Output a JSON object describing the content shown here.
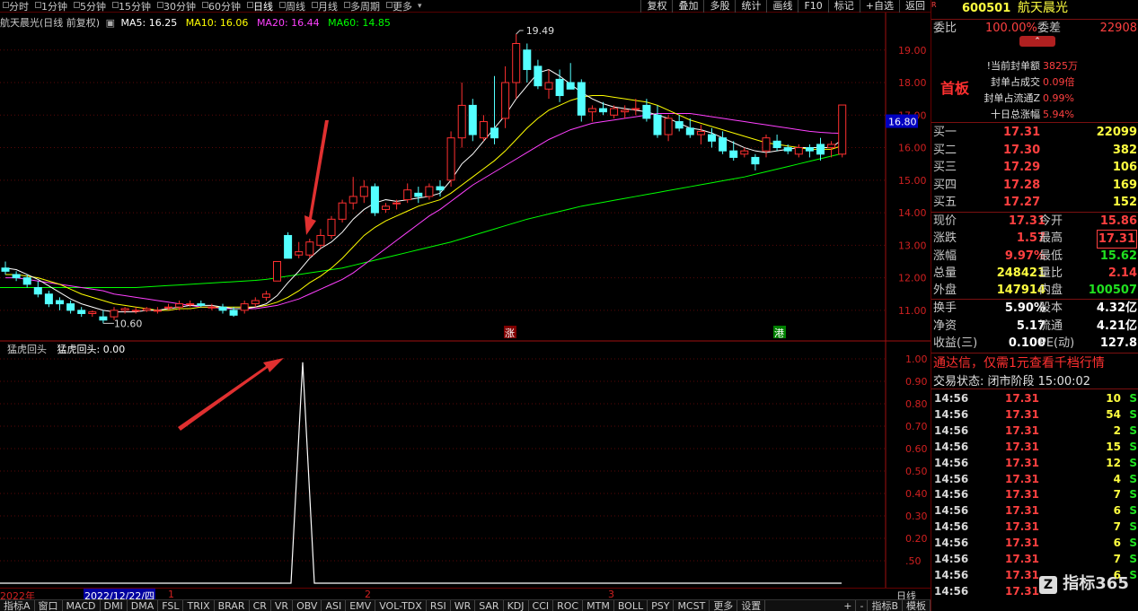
{
  "topbar": {
    "tabs": [
      "分时",
      "1分钟",
      "5分钟",
      "15分钟",
      "30分钟",
      "60分钟",
      "日线",
      "周线",
      "月线",
      "多周期",
      "更多"
    ],
    "active_tab": "日线",
    "buttons": [
      "复权",
      "叠加",
      "多股",
      "统计",
      "画线",
      "F10",
      "标记",
      "+自选",
      "返回"
    ]
  },
  "legend": {
    "title": "航天晨光(日线 前复权)",
    "ma5": "MA5: 16.25",
    "ma10": "MA10: 16.06",
    "ma20": "MA20: 16.44",
    "ma60": "MA60: 14.85",
    "colors": {
      "ma5": "#ffffff",
      "ma10": "#ffff00",
      "ma20": "#ff40ff",
      "ma60": "#00ff00"
    }
  },
  "indicator": {
    "title": "猛虎回头",
    "value_label": "猛虎回头: 0.00"
  },
  "price_axis": {
    "labels": [
      "19.00",
      "18.00",
      "17.00",
      "16.00",
      "15.00",
      "14.00",
      "13.00",
      "12.00",
      "11.00"
    ],
    "current": "16.80",
    "high_label": "19.49",
    "low_label": "10.60",
    "mark_zhang": "涨",
    "mark_gang": "港"
  },
  "indicator_axis": {
    "labels": [
      "1.00",
      "0.90",
      "0.80",
      "0.70",
      "0.60",
      "0.50",
      "0.40",
      "0.30",
      "0.20",
      ".50"
    ]
  },
  "chart_data": {
    "type": "candlestick",
    "title": "航天晨光(日线 前复权)",
    "ylim": [
      10.5,
      19.6
    ],
    "candles": [
      [
        12.3,
        12.5,
        12.1,
        12.2
      ],
      [
        12.1,
        12.2,
        11.9,
        12.0
      ],
      [
        12.0,
        12.1,
        11.7,
        11.8
      ],
      [
        11.7,
        11.9,
        11.4,
        11.5
      ],
      [
        11.5,
        11.6,
        11.1,
        11.2
      ],
      [
        11.3,
        11.4,
        11.0,
        11.2
      ],
      [
        11.2,
        11.3,
        10.9,
        11.0
      ],
      [
        11.0,
        11.1,
        10.8,
        10.9
      ],
      [
        10.9,
        11.0,
        10.8,
        10.95
      ],
      [
        10.8,
        11.0,
        10.6,
        10.7
      ],
      [
        10.8,
        11.1,
        10.7,
        11.0
      ],
      [
        11.0,
        11.1,
        10.9,
        11.05
      ],
      [
        11.0,
        11.1,
        10.9,
        11.0
      ],
      [
        11.0,
        11.1,
        10.95,
        11.05
      ],
      [
        11.0,
        11.1,
        10.9,
        11.0
      ],
      [
        11.1,
        11.2,
        11.0,
        11.1
      ],
      [
        11.1,
        11.3,
        11.0,
        11.2
      ],
      [
        11.2,
        11.3,
        11.1,
        11.2
      ],
      [
        11.2,
        11.3,
        11.1,
        11.15
      ],
      [
        11.1,
        11.2,
        11.0,
        11.1
      ],
      [
        11.1,
        11.2,
        10.9,
        11.0
      ],
      [
        11.0,
        11.1,
        10.8,
        10.85
      ],
      [
        11.0,
        11.3,
        10.9,
        11.2
      ],
      [
        11.2,
        11.4,
        11.1,
        11.3
      ],
      [
        11.4,
        11.6,
        11.3,
        11.5
      ],
      [
        11.9,
        12.5,
        11.9,
        12.5
      ],
      [
        13.3,
        13.4,
        12.6,
        12.6
      ],
      [
        12.7,
        13.1,
        12.6,
        12.8
      ],
      [
        12.7,
        13.2,
        12.6,
        13.1
      ],
      [
        13.0,
        13.5,
        12.9,
        13.3
      ],
      [
        13.3,
        13.9,
        13.2,
        13.8
      ],
      [
        13.8,
        14.4,
        13.7,
        14.3
      ],
      [
        14.3,
        15.1,
        14.1,
        14.5
      ],
      [
        14.5,
        15.0,
        14.3,
        14.8
      ],
      [
        14.8,
        14.9,
        13.9,
        14.0
      ],
      [
        14.1,
        14.3,
        14.0,
        14.2
      ],
      [
        14.3,
        14.4,
        14.1,
        14.3
      ],
      [
        14.4,
        14.9,
        14.3,
        14.7
      ],
      [
        14.6,
        14.8,
        14.3,
        14.5
      ],
      [
        14.5,
        14.9,
        14.4,
        14.8
      ],
      [
        14.8,
        15.0,
        14.5,
        14.7
      ],
      [
        15.0,
        16.5,
        14.8,
        16.3
      ],
      [
        16.3,
        18.0,
        16.0,
        17.3
      ],
      [
        17.3,
        17.5,
        16.2,
        16.4
      ],
      [
        16.3,
        17.0,
        16.2,
        16.8
      ],
      [
        16.6,
        18.2,
        16.1,
        16.3
      ],
      [
        16.9,
        18.5,
        16.6,
        18.0
      ],
      [
        18.0,
        19.49,
        17.5,
        19.2
      ],
      [
        19.0,
        19.2,
        18.0,
        18.4
      ],
      [
        18.5,
        18.7,
        17.8,
        17.9
      ],
      [
        17.8,
        18.4,
        17.5,
        18.0
      ],
      [
        18.1,
        18.4,
        17.4,
        17.6
      ],
      [
        18.0,
        18.6,
        17.8,
        17.8
      ],
      [
        18.0,
        18.1,
        16.8,
        17.0
      ],
      [
        17.1,
        17.3,
        16.8,
        17.2
      ],
      [
        17.2,
        17.4,
        17.0,
        17.1
      ],
      [
        17.0,
        17.3,
        16.9,
        17.2
      ],
      [
        17.1,
        17.3,
        16.9,
        17.15
      ],
      [
        17.2,
        17.5,
        17.0,
        17.2
      ],
      [
        17.3,
        17.5,
        16.8,
        16.9
      ],
      [
        17.0,
        17.3,
        16.3,
        16.4
      ],
      [
        16.4,
        17.0,
        16.2,
        16.9
      ],
      [
        16.8,
        17.0,
        16.5,
        16.6
      ],
      [
        16.6,
        16.9,
        16.3,
        16.4
      ],
      [
        16.4,
        16.7,
        16.1,
        16.5
      ],
      [
        16.4,
        16.6,
        16.0,
        16.2
      ],
      [
        16.3,
        16.5,
        15.8,
        15.9
      ],
      [
        15.9,
        16.2,
        15.6,
        15.7
      ],
      [
        15.8,
        16.0,
        15.7,
        15.9
      ],
      [
        15.7,
        15.8,
        15.3,
        15.5
      ],
      [
        15.9,
        16.4,
        15.7,
        16.3
      ],
      [
        16.2,
        16.4,
        15.9,
        16.0
      ],
      [
        16.0,
        16.1,
        15.8,
        15.9
      ],
      [
        15.8,
        16.1,
        15.7,
        16.0
      ],
      [
        16.0,
        16.1,
        15.7,
        15.9
      ],
      [
        16.1,
        16.3,
        15.6,
        15.8
      ],
      [
        16.0,
        16.2,
        15.7,
        16.1
      ],
      [
        15.8,
        17.31,
        15.7,
        17.31
      ]
    ],
    "ma5": [
      12.3,
      12.25,
      12.1,
      11.95,
      11.75,
      11.55,
      11.35,
      11.2,
      11.1,
      11.0,
      10.95,
      10.95,
      10.95,
      11.0,
      11.0,
      11.05,
      11.1,
      11.15,
      11.15,
      11.15,
      11.1,
      11.05,
      11.05,
      11.1,
      11.2,
      11.45,
      11.85,
      12.2,
      12.6,
      12.9,
      13.1,
      13.4,
      13.8,
      14.1,
      14.3,
      14.4,
      14.35,
      14.4,
      14.45,
      14.5,
      14.6,
      15.0,
      15.5,
      15.8,
      16.2,
      16.6,
      17.0,
      17.5,
      17.9,
      18.3,
      18.4,
      18.2,
      17.95,
      17.7,
      17.5,
      17.35,
      17.25,
      17.2,
      17.15,
      17.1,
      17.0,
      16.9,
      16.75,
      16.6,
      16.55,
      16.45,
      16.3,
      16.15,
      16.0,
      15.9,
      15.85,
      15.9,
      15.95,
      16.0,
      16.0,
      16.0,
      16.0,
      16.25
    ],
    "ma10": [
      12.1,
      12.1,
      12.05,
      12.0,
      11.9,
      11.8,
      11.65,
      11.5,
      11.4,
      11.3,
      11.2,
      11.15,
      11.1,
      11.05,
      11.0,
      11.0,
      11.05,
      11.05,
      11.1,
      11.1,
      11.1,
      11.1,
      11.1,
      11.1,
      11.15,
      11.25,
      11.4,
      11.6,
      11.85,
      12.05,
      12.3,
      12.6,
      12.95,
      13.3,
      13.55,
      13.75,
      13.9,
      14.05,
      14.2,
      14.3,
      14.4,
      14.6,
      14.85,
      15.1,
      15.35,
      15.6,
      15.9,
      16.25,
      16.6,
      16.9,
      17.15,
      17.3,
      17.45,
      17.55,
      17.6,
      17.6,
      17.55,
      17.5,
      17.45,
      17.4,
      17.3,
      17.15,
      17.0,
      16.85,
      16.75,
      16.65,
      16.55,
      16.45,
      16.35,
      16.25,
      16.15,
      16.1,
      16.05,
      16.0,
      15.95,
      15.95,
      15.95,
      16.06
    ],
    "ma20": [
      12.0,
      12.0,
      11.95,
      11.9,
      11.85,
      11.8,
      11.75,
      11.7,
      11.65,
      11.6,
      11.5,
      11.45,
      11.4,
      11.35,
      11.3,
      11.25,
      11.2,
      11.15,
      11.1,
      11.1,
      11.05,
      11.05,
      11.05,
      11.05,
      11.1,
      11.15,
      11.25,
      11.35,
      11.5,
      11.65,
      11.8,
      11.95,
      12.15,
      12.4,
      12.65,
      12.9,
      13.15,
      13.4,
      13.65,
      13.9,
      14.1,
      14.35,
      14.6,
      14.85,
      15.05,
      15.25,
      15.45,
      15.65,
      15.85,
      16.05,
      16.25,
      16.4,
      16.55,
      16.65,
      16.75,
      16.8,
      16.85,
      16.9,
      16.95,
      17.0,
      17.05,
      17.05,
      17.05,
      17.05,
      17.0,
      16.95,
      16.9,
      16.85,
      16.8,
      16.75,
      16.7,
      16.65,
      16.6,
      16.55,
      16.5,
      16.47,
      16.45,
      16.44
    ],
    "ma60": [
      11.7,
      11.7,
      11.7,
      11.7,
      11.7,
      11.7,
      11.7,
      11.7,
      11.7,
      11.7,
      11.7,
      11.7,
      11.7,
      11.72,
      11.74,
      11.76,
      11.78,
      11.8,
      11.82,
      11.84,
      11.86,
      11.88,
      11.9,
      11.92,
      11.95,
      12.0,
      12.05,
      12.1,
      12.15,
      12.2,
      12.25,
      12.3,
      12.38,
      12.46,
      12.54,
      12.62,
      12.7,
      12.78,
      12.86,
      12.94,
      13.02,
      13.1,
      13.2,
      13.3,
      13.4,
      13.5,
      13.6,
      13.7,
      13.8,
      13.88,
      13.96,
      14.04,
      14.12,
      14.2,
      14.26,
      14.32,
      14.38,
      14.44,
      14.5,
      14.56,
      14.62,
      14.68,
      14.74,
      14.8,
      14.86,
      14.92,
      14.98,
      15.04,
      15.1,
      15.18,
      15.26,
      15.34,
      15.42,
      15.5,
      15.58,
      15.66,
      15.74,
      15.82
    ],
    "indicator_values": [
      0,
      0,
      0,
      0,
      0,
      0,
      0,
      0,
      0,
      0,
      0,
      0,
      0,
      0,
      0,
      0,
      0,
      0,
      0,
      0,
      0,
      0,
      0,
      0,
      0,
      0,
      0,
      1,
      0,
      0,
      0,
      0,
      0,
      0,
      0,
      0,
      0,
      0,
      0,
      0,
      0,
      0,
      0,
      0,
      0,
      0,
      0,
      0,
      0,
      0,
      0,
      0,
      0,
      0,
      0,
      0,
      0,
      0,
      0,
      0,
      0,
      0,
      0,
      0,
      0,
      0,
      0,
      0,
      0,
      0,
      0,
      0,
      0,
      0,
      0,
      0,
      0,
      0
    ]
  },
  "datebar": {
    "year": "2022年",
    "cursor": "2022/12/22/四",
    "months": [
      "1",
      "2",
      "3"
    ],
    "period": "日线"
  },
  "bottombar": {
    "items": [
      "指标A",
      "窗口",
      "MACD",
      "DMI",
      "DMA",
      "FSL",
      "TRIX",
      "BRAR",
      "CR",
      "VR",
      "OBV",
      "ASI",
      "EMV",
      "VOL-TDX",
      "RSI",
      "WR",
      "SAR",
      "KDJ",
      "CCI",
      "ROC",
      "MTM",
      "BOLL",
      "PSY",
      "MCST",
      "更多",
      "设置"
    ],
    "right": [
      "+",
      "-",
      "指标B",
      "模板"
    ]
  },
  "panel": {
    "code": "600501",
    "name": "航天晨光",
    "weibi_label": "委比",
    "weibi_value": "100.00%",
    "weicha_label": "委差",
    "weicha_value": "22908",
    "badge": "首板",
    "info": [
      {
        "label": "!当前封单额",
        "value": "3825万"
      },
      {
        "label": "封单占成交",
        "value": "0.09倍"
      },
      {
        "label": "封单占流通Z",
        "value": "0.99%"
      },
      {
        "label": "十日总涨幅",
        "value": "5.94%"
      }
    ],
    "buy": [
      {
        "label": "买一",
        "price": "17.31",
        "vol": "22099"
      },
      {
        "label": "买二",
        "price": "17.30",
        "vol": "382"
      },
      {
        "label": "买三",
        "price": "17.29",
        "vol": "106"
      },
      {
        "label": "买四",
        "price": "17.28",
        "vol": "169"
      },
      {
        "label": "买五",
        "price": "17.27",
        "vol": "152"
      }
    ],
    "quote": [
      {
        "l1": "现价",
        "v1": "17.31",
        "l2": "今开",
        "v2": "15.86"
      },
      {
        "l1": "涨跌",
        "v1": "1.57",
        "l2": "最高",
        "v2": "17.31"
      },
      {
        "l1": "涨幅",
        "v1": "9.97%",
        "l2": "最低",
        "v2": "15.62"
      },
      {
        "l1": "总量",
        "v1": "248421",
        "l2": "量比",
        "v2": "2.14"
      },
      {
        "l1": "外盘",
        "v1": "147914",
        "l2": "内盘",
        "v2": "100507"
      }
    ],
    "quote2": [
      {
        "l1": "换手",
        "v1": "5.90%",
        "l2": "股本",
        "v2": "4.32亿"
      },
      {
        "l1": "净资",
        "v1": "5.17",
        "l2": "流通",
        "v2": "4.21亿"
      },
      {
        "l1": "收益(三)",
        "v1": "0.100",
        "l2": "PE(动)",
        "v2": "127.8"
      }
    ],
    "promo": "通达信，仅需1元查看千档行情",
    "status": "交易状态: 闭市阶段 15:00:02",
    "ticks": [
      {
        "t": "14:56",
        "p": "17.31",
        "v": "10",
        "s": "S"
      },
      {
        "t": "14:56",
        "p": "17.31",
        "v": "54",
        "s": "S"
      },
      {
        "t": "14:56",
        "p": "17.31",
        "v": "2",
        "s": "S"
      },
      {
        "t": "14:56",
        "p": "17.31",
        "v": "15",
        "s": "S"
      },
      {
        "t": "14:56",
        "p": "17.31",
        "v": "12",
        "s": "S"
      },
      {
        "t": "14:56",
        "p": "17.31",
        "v": "4",
        "s": "S"
      },
      {
        "t": "14:56",
        "p": "17.31",
        "v": "7",
        "s": "S"
      },
      {
        "t": "14:56",
        "p": "17.31",
        "v": "6",
        "s": "S"
      },
      {
        "t": "14:56",
        "p": "17.31",
        "v": "7",
        "s": "S"
      },
      {
        "t": "14:56",
        "p": "17.31",
        "v": "6",
        "s": "S"
      },
      {
        "t": "14:56",
        "p": "17.31",
        "v": "7",
        "s": "S"
      },
      {
        "t": "14:56",
        "p": "17.31",
        "v": "6",
        "s": "S"
      },
      {
        "t": "14:56",
        "p": "17.31",
        "v": "",
        "s": ""
      }
    ],
    "watermark": "指标365"
  }
}
